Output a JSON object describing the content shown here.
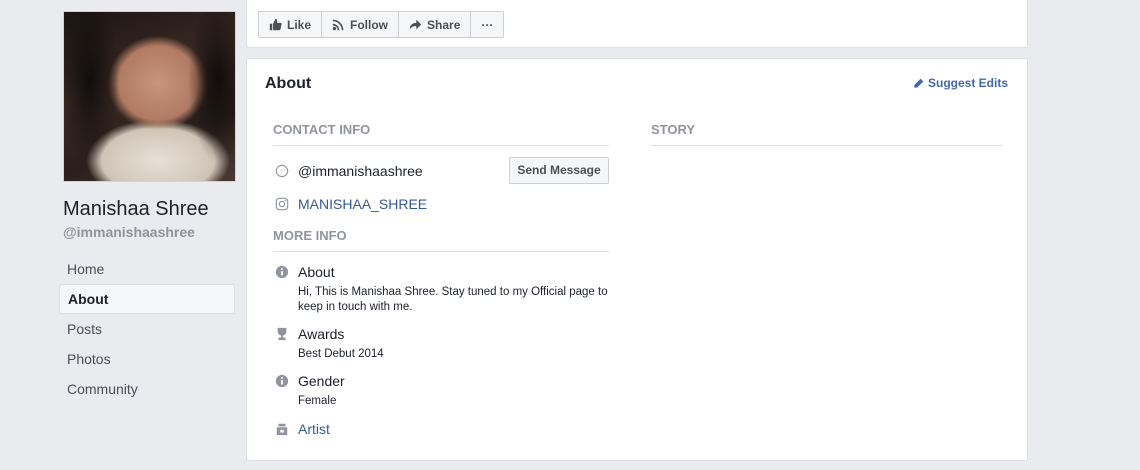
{
  "profile": {
    "name": "Manishaa Shree",
    "handle": "@immanishaashree"
  },
  "left_nav": [
    {
      "label": "Home",
      "active": false
    },
    {
      "label": "About",
      "active": true
    },
    {
      "label": "Posts",
      "active": false
    },
    {
      "label": "Photos",
      "active": false
    },
    {
      "label": "Community",
      "active": false
    }
  ],
  "actions": {
    "like": "Like",
    "follow": "Follow",
    "share": "Share",
    "more": "···"
  },
  "about": {
    "title": "About",
    "suggest_edits": "Suggest Edits",
    "contact_info_heading": "CONTACT INFO",
    "story_heading": "STORY",
    "messenger_handle": "@immanishaashree",
    "send_message": "Send Message",
    "instagram": "MANISHAA_SHREE",
    "more_info_heading": "MORE INFO",
    "about_label": "About",
    "about_text": "Hi, This is Manishaa Shree. Stay tuned to my Official page to keep in touch with me.",
    "awards_label": "Awards",
    "awards_text": "Best Debut 2014",
    "gender_label": "Gender",
    "gender_text": "Female",
    "category": "Artist"
  },
  "colors": {
    "background": "#e9ebee",
    "link": "#365899",
    "accent": "#4267b2",
    "muted": "#90949c"
  }
}
